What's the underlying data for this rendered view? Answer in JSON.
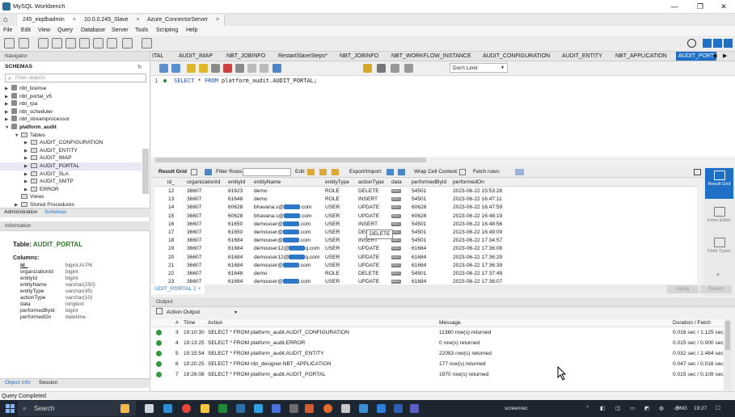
{
  "window": {
    "title": "MySQL Workbench",
    "controls": [
      "—",
      "❐",
      "✕"
    ]
  },
  "connection_tabs": [
    {
      "label": "245_eiqdbadmin"
    },
    {
      "label": "10.0.0.245_Slave"
    },
    {
      "label": "Azure_ConnectorServer"
    }
  ],
  "menu": [
    "File",
    "Edit",
    "View",
    "Query",
    "Database",
    "Server",
    "Tools",
    "Scripting",
    "Help"
  ],
  "navigator": {
    "header": "Navigator",
    "schemas_label": "SCHEMAS",
    "filter_placeholder": "Filter objects",
    "tree": [
      {
        "label": "nbt_license",
        "kind": "db",
        "level": 0
      },
      {
        "label": "nbt_portal_v5",
        "kind": "db",
        "level": 0
      },
      {
        "label": "nbt_rpa",
        "kind": "db",
        "level": 0
      },
      {
        "label": "nbt_scheduler",
        "kind": "db",
        "level": 0
      },
      {
        "label": "nbt_streamprocessor",
        "kind": "db",
        "level": 0
      },
      {
        "label": "platform_audit",
        "kind": "db-open",
        "level": 0
      },
      {
        "label": "Tables",
        "kind": "folder",
        "level": 1
      },
      {
        "label": "AUDIT_CONFIGURATION",
        "kind": "table",
        "level": 2
      },
      {
        "label": "AUDIT_ENTITY",
        "kind": "table",
        "level": 2
      },
      {
        "label": "AUDIT_IMAP",
        "kind": "table",
        "level": 2
      },
      {
        "label": "AUDIT_PORTAL",
        "kind": "table",
        "level": 2,
        "selected": true
      },
      {
        "label": "AUDIT_SLA",
        "kind": "table",
        "level": 2
      },
      {
        "label": "AUDIT_SMTP",
        "kind": "table",
        "level": 2
      },
      {
        "label": "ERROR",
        "kind": "table",
        "level": 2
      },
      {
        "label": "Views",
        "kind": "folder",
        "level": 1
      },
      {
        "label": "Stored Procedures",
        "kind": "folder",
        "level": 1
      }
    ],
    "tabs": [
      "Administration",
      "Schemas"
    ]
  },
  "information": {
    "header": "Information",
    "table_label": "Table:",
    "table_name": "AUDIT_PORTAL",
    "columns_label": "Columns:",
    "columns": [
      {
        "name": "id_",
        "type": "bigint AI PK"
      },
      {
        "name": "organizationId",
        "type": "bigint"
      },
      {
        "name": "entityId",
        "type": "bigint"
      },
      {
        "name": "entityName",
        "type": "varchar(250)"
      },
      {
        "name": "entityType",
        "type": "varchar(45)"
      },
      {
        "name": "actionType",
        "type": "varchar(10)"
      },
      {
        "name": "data",
        "type": "longtext"
      },
      {
        "name": "performedById",
        "type": "bigint"
      },
      {
        "name": "performedOn",
        "type": "datetime"
      }
    ],
    "tabs": [
      "Object Info",
      "Session"
    ]
  },
  "query_tabs": [
    "ITAL",
    "AUDIT_IMAP",
    "NBT_JOBINFO",
    "RestartSlaveSteps*",
    "NBT_JOBINFO",
    "NBT_WORKFLOW_INSTANCE",
    "AUDIT_CONFIGURATION",
    "AUDIT_ENTITY",
    "NBT_APPLICATION",
    "AUDIT_PORT"
  ],
  "query_toolbar": {
    "limit": "Don't Limit"
  },
  "editor": {
    "line": "1",
    "keyword1": "SELECT",
    "middle": " * ",
    "keyword2": "FROM",
    "rest": " platform_audit.AUDIT_PORTAL;"
  },
  "result_toolbar": {
    "result_grid": "Result Grid",
    "filter_rows": "Filter Rows:",
    "edit": "Edit:",
    "export_import": "Export/Import:",
    "wrap": "Wrap Cell Content:",
    "fetch": "Fetch rows:"
  },
  "grid": {
    "columns": [
      "id_",
      "organizationId",
      "entityId",
      "entityName",
      "entityType",
      "actionType",
      "data",
      "performedById",
      "performedOn"
    ],
    "rows": [
      {
        "id": "12",
        "org": "36607",
        "eid": "61623",
        "name": "demo",
        "redact": false,
        "etype": "ROLE",
        "atype": "DELETE",
        "data": "NULL",
        "by": "54501",
        "on": "2023-06-22 15:53:28"
      },
      {
        "id": "13",
        "org": "36607",
        "eid": "61648",
        "name": "demo",
        "redact": false,
        "etype": "ROLE",
        "atype": "INSERT",
        "data": "NULL",
        "by": "54501",
        "on": "2023-06-22 16:47:11"
      },
      {
        "id": "14",
        "org": "36607",
        "eid": "60628",
        "name": "bhavana.s@",
        "name_tail": ".com",
        "redact": true,
        "etype": "USER",
        "atype": "UPDATE",
        "data": "NULL",
        "by": "60628",
        "on": "2023-06-22 16:47:59"
      },
      {
        "id": "15",
        "org": "36607",
        "eid": "60628",
        "name": "bhavana.s@",
        "name_tail": ".com",
        "redact": true,
        "etype": "USER",
        "atype": "UPDATE",
        "data": "NULL",
        "by": "60628",
        "on": "2023-06-22 16:48:19"
      },
      {
        "id": "16",
        "org": "36607",
        "eid": "61650",
        "name": "demouser@",
        "name_tail": ".com",
        "redact": true,
        "etype": "USER",
        "atype": "INSERT",
        "data": "NULL",
        "by": "54501",
        "on": "2023-06-22 16:48:56"
      },
      {
        "id": "17",
        "org": "36607",
        "eid": "61650",
        "name": "demouser@",
        "name_tail": ".com",
        "redact": true,
        "etype": "USER",
        "atype": "DELE",
        "data": "NULL",
        "by": "54501",
        "on": "2023-06-22 16:49:09"
      },
      {
        "id": "18",
        "org": "36607",
        "eid": "61684",
        "name": "demouser@",
        "name_tail": ".com",
        "redact": true,
        "etype": "USER",
        "atype": "INSERT",
        "data": "NULL",
        "by": "54501",
        "on": "2023-06-22 17:34:57"
      },
      {
        "id": "19",
        "org": "36607",
        "eid": "61684",
        "name": "demouser12@",
        "name_tail": "q.com",
        "redact": true,
        "etype": "USER",
        "atype": "UPDATE",
        "data": "NULL",
        "by": "61684",
        "on": "2023-06-22 17:36:08"
      },
      {
        "id": "20",
        "org": "36607",
        "eid": "61684",
        "name": "demouser12@",
        "name_tail": "q.com",
        "redact": true,
        "etype": "USER",
        "atype": "UPDATE",
        "data": "NULL",
        "by": "61684",
        "on": "2023-06-22 17:36:29"
      },
      {
        "id": "21",
        "org": "36607",
        "eid": "61684",
        "name": "demouser@",
        "name_tail": ".com",
        "redact": true,
        "etype": "USER",
        "atype": "UPDATE",
        "data": "NULL",
        "by": "61684",
        "on": "2023-06-22 17:36:39"
      },
      {
        "id": "22",
        "org": "36607",
        "eid": "61648",
        "name": "demo",
        "redact": false,
        "etype": "ROLE",
        "atype": "DELETE",
        "data": "NULL",
        "by": "54501",
        "on": "2023-06-22 17:37:49"
      },
      {
        "id": "23",
        "org": "36607",
        "eid": "61684",
        "name": "demouser@",
        "name_tail": ".com",
        "redact": true,
        "etype": "USER",
        "atype": "UPDATE",
        "data": "NULL",
        "by": "61684",
        "on": "2023-06-22 17:38:07"
      }
    ],
    "tooltip": "DELETE"
  },
  "side_panel": [
    {
      "label": "Result Grid",
      "active": true
    },
    {
      "label": "Form Editor",
      "active": false
    },
    {
      "label": "Field Types",
      "active": false
    }
  ],
  "result_tabs": {
    "active": "UDIT_PORTAL 1",
    "apply": "Apply",
    "revert": "Revert"
  },
  "output": {
    "header": "Output",
    "selector": "Action Output",
    "columns": [
      "#",
      "Time",
      "Action",
      "Message",
      "Duration / Fetch"
    ],
    "rows": [
      {
        "n": "3",
        "time": "19:10:30",
        "action": "SELECT * FROM platform_audit.AUDIT_CONFIGURATION",
        "message": "11360 row(s) returned",
        "duration": "0.016 sec / 1.125 sec"
      },
      {
        "n": "4",
        "time": "19:13:25",
        "action": "SELECT * FROM platform_audit.ERROR",
        "message": "0 row(s) returned",
        "duration": "0.015 sec / 0.000 sec"
      },
      {
        "n": "5",
        "time": "19:15:54",
        "action": "SELECT * FROM platform_audit.AUDIT_ENTITY",
        "message": "22083 row(s) returned",
        "duration": "0.032 sec / 2.484 sec"
      },
      {
        "n": "6",
        "time": "19:20:25",
        "action": "SELECT * FROM nbt_designer.NBT_APPLICATION",
        "message": "177 row(s) returned",
        "duration": "0.047 sec / 0.016 sec"
      },
      {
        "n": "7",
        "time": "19:26:08",
        "action": "SELECT * FROM platform_audit.AUDIT_PORTAL",
        "message": "1970 row(s) returned",
        "duration": "0.015 sec / 0.109 sec"
      }
    ]
  },
  "status": "Query Completed",
  "taskbar": {
    "search": "Search",
    "watermark": "screenrec",
    "lang": "ENG",
    "time": "19:27"
  },
  "colors": {
    "accent": "#1f6fc7",
    "ok": "#2f9a3a",
    "taskbar": "#1c2530"
  }
}
